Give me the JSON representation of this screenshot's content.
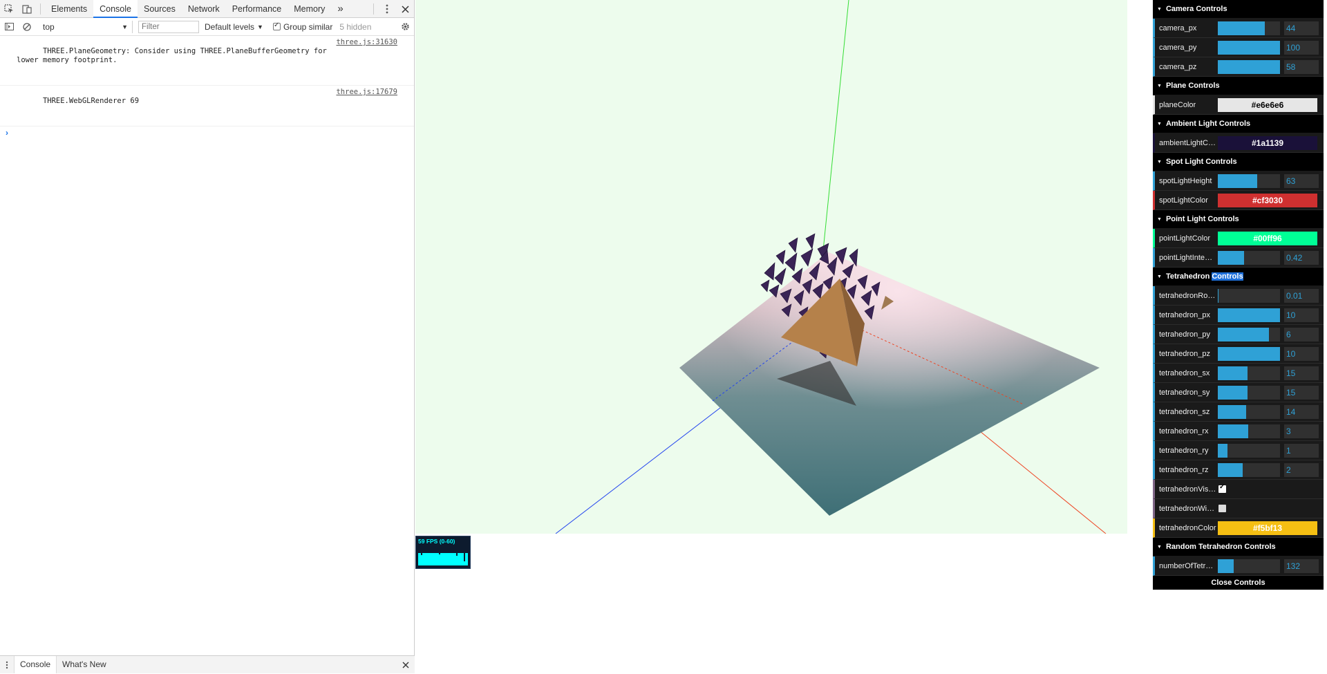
{
  "devtools": {
    "tabs": [
      "Elements",
      "Console",
      "Sources",
      "Network",
      "Performance",
      "Memory"
    ],
    "more_label": "»",
    "context": "top",
    "filter_placeholder": "Filter",
    "levels_label": "Default levels",
    "group_similar_label": "Group similar",
    "hidden_label": "5 hidden",
    "messages": [
      {
        "text": "THREE.PlaneGeometry: Consider using THREE.PlaneBufferGeometry for\nlower memory footprint.",
        "source": "three.js:31630"
      },
      {
        "text": "THREE.WebGLRenderer 69",
        "source": "three.js:17679"
      }
    ],
    "prompt": "›",
    "drawer_tabs": [
      "Console",
      "What's New"
    ]
  },
  "stats": {
    "label": "59 FPS (0-60)"
  },
  "gui": {
    "camera": {
      "title": "Camera Controls",
      "rows": [
        {
          "label": "camera_px",
          "value": "44",
          "fraction": 0.76
        },
        {
          "label": "camera_py",
          "value": "100",
          "fraction": 1.0
        },
        {
          "label": "camera_pz",
          "value": "58",
          "fraction": 1.0
        }
      ]
    },
    "plane": {
      "title": "Plane Controls",
      "label": "planeColor",
      "value": "#e6e6e6",
      "bg": "#e6e6e6",
      "fg": "#000000"
    },
    "ambient": {
      "title": "Ambient Light Controls",
      "label": "ambientLightColor",
      "value": "#1a1139",
      "bg": "#1a1139",
      "fg": "#ffffff"
    },
    "spot": {
      "title": "Spot Light Controls",
      "height_label": "spotLightHeight",
      "height_value": "63",
      "height_fraction": 0.63,
      "color_label": "spotLightColor",
      "color_value": "#cf3030",
      "color_bg": "#cf3030",
      "color_fg": "#ffffff"
    },
    "point": {
      "title": "Point Light Controls",
      "color_label": "pointLightColor",
      "color_value": "#00ff96",
      "color_bg": "#00ff96",
      "color_fg": "#ffffff",
      "intensity_label": "pointLightIntensity",
      "intensity_value": "0.42",
      "intensity_fraction": 0.42
    },
    "tetra": {
      "title_a": "Tetrahedron",
      "title_b": "Controls",
      "sliders": [
        {
          "label": "tetrahedronRotationSpeed",
          "value": "0.01",
          "fraction": 0.01
        },
        {
          "label": "tetrahedron_px",
          "value": "10",
          "fraction": 1.0
        },
        {
          "label": "tetrahedron_py",
          "value": "6",
          "fraction": 0.82
        },
        {
          "label": "tetrahedron_pz",
          "value": "10",
          "fraction": 1.0
        },
        {
          "label": "tetrahedron_sx",
          "value": "15",
          "fraction": 0.48
        },
        {
          "label": "tetrahedron_sy",
          "value": "15",
          "fraction": 0.48
        },
        {
          "label": "tetrahedron_sz",
          "value": "14",
          "fraction": 0.45
        },
        {
          "label": "tetrahedron_rx",
          "value": "3",
          "fraction": 0.49
        },
        {
          "label": "tetrahedron_ry",
          "value": "1",
          "fraction": 0.16
        },
        {
          "label": "tetrahedron_rz",
          "value": "2",
          "fraction": 0.4
        }
      ],
      "visible_label": "tetrahedronVisible",
      "visible_checked": true,
      "wire_label": "tetrahedronWireframe",
      "wire_checked": false,
      "color_label": "tetrahedronColor",
      "color_value": "#f5bf13",
      "color_bg": "#f5bf13",
      "color_fg": "#ffffff"
    },
    "random": {
      "title": "Random Tetrahedron Controls",
      "label": "numberOfTetrahedrons",
      "value": "132",
      "fraction": 0.26
    },
    "close_label": "Close Controls"
  }
}
